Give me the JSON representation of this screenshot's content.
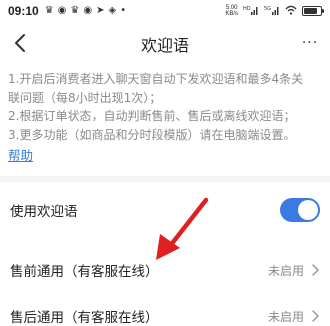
{
  "status_bar": {
    "time": "09:10",
    "net_speed_value": "5.00",
    "net_speed_unit": "KB/s",
    "battery_level": 0.85
  },
  "header": {
    "title": "欢迎语",
    "more_label": "···"
  },
  "notice": {
    "lines": [
      "1.开启后消费者进入聊天窗自动下发欢迎语和最多4条关",
      "联问题（每8小时出现1次）；",
      "2.根据订单状态，自动判断售前、售后或离线欢迎语；",
      "3.更多功能（如商品和分时段模版）请在电脑端设置。"
    ],
    "help_link": "帮助"
  },
  "settings": {
    "use_welcome": {
      "label": "使用欢迎语",
      "enabled": true
    },
    "pre_sale": {
      "label": "售前通用（有客服在线）",
      "value": "未启用"
    },
    "after_sale": {
      "label": "售后通用（有客服在线）",
      "value": "未启用"
    }
  },
  "colors": {
    "accent": "#3b7ae0",
    "link": "#3a7bd5",
    "annotation_arrow": "#e02020"
  }
}
